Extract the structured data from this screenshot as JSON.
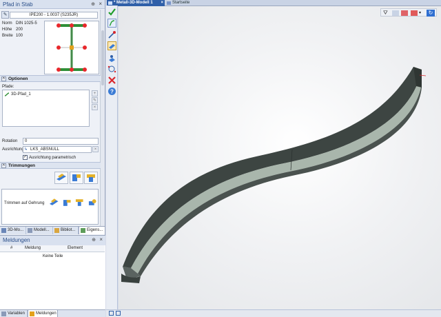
{
  "left_panel": {
    "title": "Pfad in Stab",
    "profile": "IPE200 - 1.0037 (S235JR)",
    "props": [
      {
        "label": "Norm",
        "value": "DIN 1025-5"
      },
      {
        "label": "Höhe",
        "value": "200"
      },
      {
        "label": "Breite",
        "value": "100"
      }
    ],
    "options_header": "Optionen",
    "paths_label": "Pfade:",
    "path_item": "3D-Pfad_1",
    "rotation_label": "Rotation",
    "rotation_value": "0",
    "alignment_label": "Ausrichtung",
    "alignment_value": "LKS_ABSNULL",
    "parametric_label": "Ausrichtung parametrisch",
    "parametric_checked": true,
    "trim_header": "Trimmungen",
    "miter_label": "Trimmen auf Gehrung",
    "tabs": [
      "3D-Mo...",
      "Modell...",
      "Bibliot...",
      "Eigens..."
    ]
  },
  "messages": {
    "title": "Meldungen",
    "columns": [
      "#",
      "Meldung",
      "Element"
    ],
    "empty_text": "Keine Teile",
    "tabs": [
      "Variablen",
      "Meldungen"
    ]
  },
  "documents": {
    "tabs": [
      "* Metall-3D-Modell 1",
      "Startseite"
    ]
  },
  "colors": {
    "accent": "#2f5fa8",
    "beam_face": "#8c9990",
    "beam_dark": "#3d4542",
    "beam_light": "#a9b6ac",
    "check_green": "#1f9d2b",
    "cancel_red": "#d9262c"
  }
}
